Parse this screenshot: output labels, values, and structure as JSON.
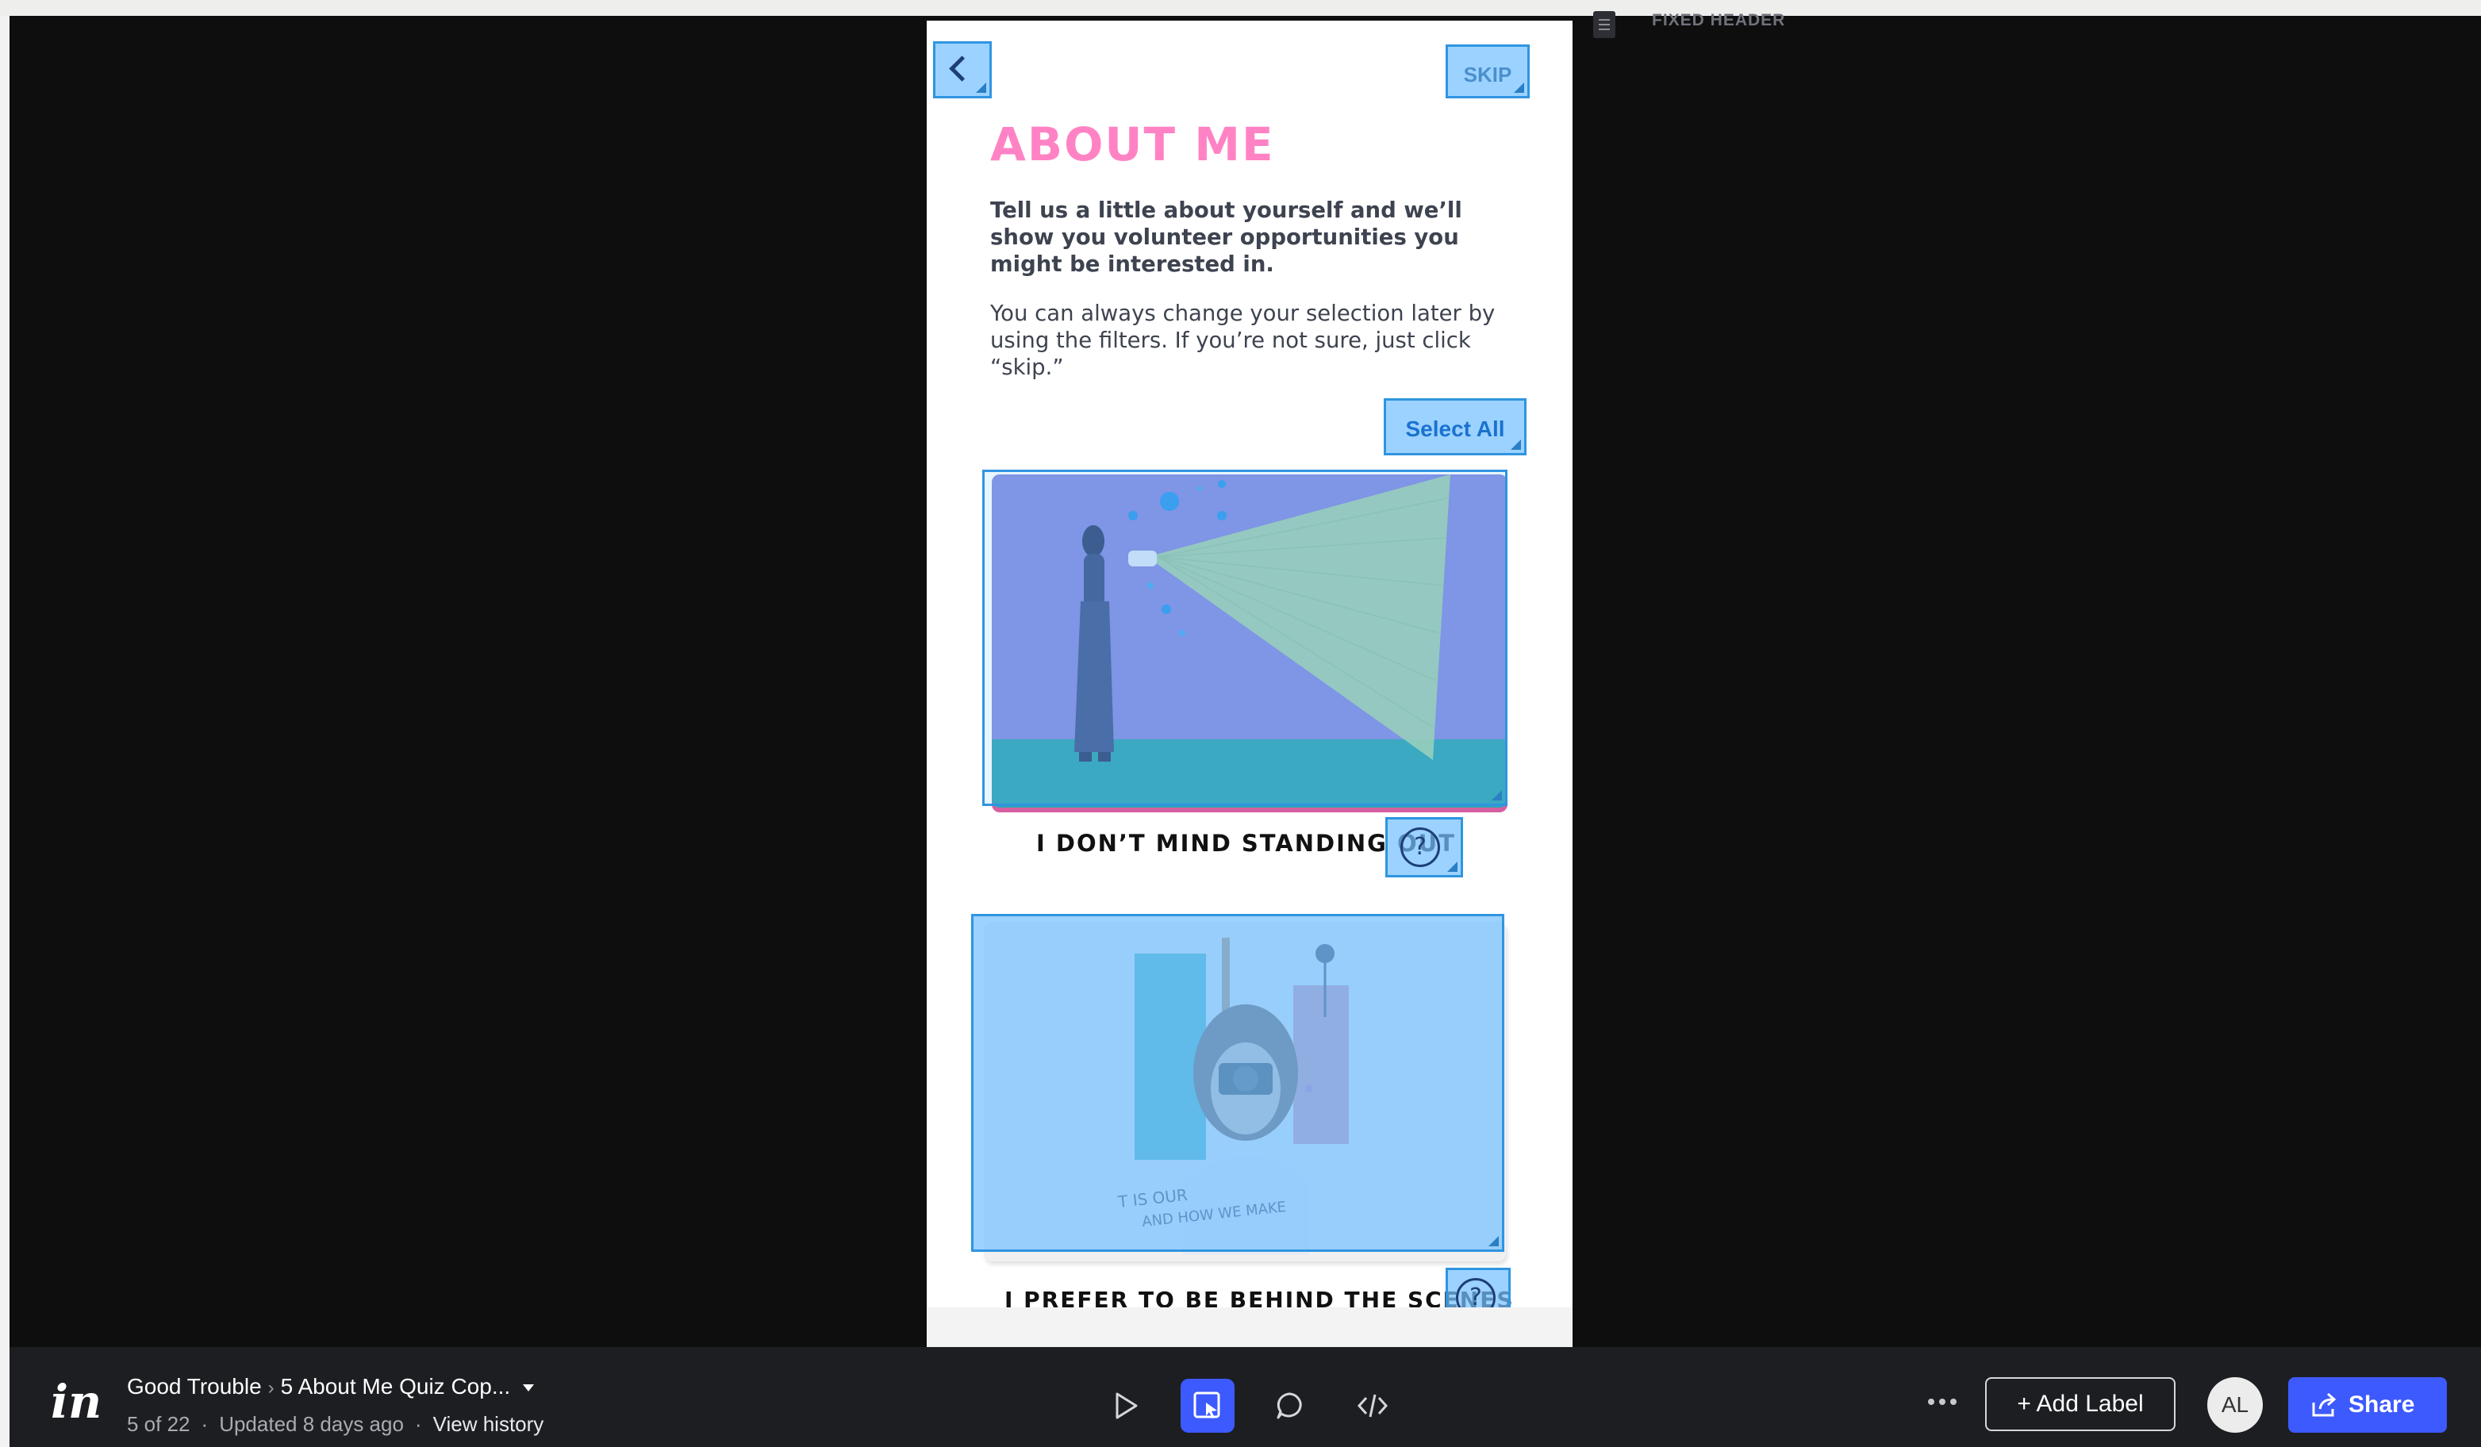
{
  "prototype": {
    "fixed_header_label": "FIXED HEADER",
    "skip_label": "SKIP",
    "title": "ABOUT ME",
    "intro_bold": "Tell us a little about yourself and we’ll show you volunteer opportunities you might be interested in.",
    "intro_regular": "You can always change your selection later by using the filters. If you’re not sure, just click “skip.”",
    "select_all_label": "Select All",
    "cards": [
      {
        "caption": "I DON’T MIND STANDING OUT",
        "help": "?"
      },
      {
        "caption": "I PREFER TO BE BEHIND THE SCENES",
        "help": "?"
      }
    ]
  },
  "toolbar": {
    "logo": "in",
    "project_name": "Good Trouble",
    "screen_name": "5 About Me Quiz Cop...",
    "screen_position": "5 of 22",
    "updated": "Updated 8 days ago",
    "history_link": "View history",
    "add_label": "+ Add Label",
    "avatar_initials": "AL",
    "share_label": "Share"
  },
  "colors": {
    "accent": "#3d5afe",
    "hotspot": "#76c0ff",
    "title_pink": "#ff83c4"
  },
  "icons": [
    "chevron-left-icon",
    "play-icon",
    "inspect-icon",
    "comment-icon",
    "code-icon",
    "more-icon",
    "share-icon",
    "help-icon",
    "caret-down-icon"
  ]
}
